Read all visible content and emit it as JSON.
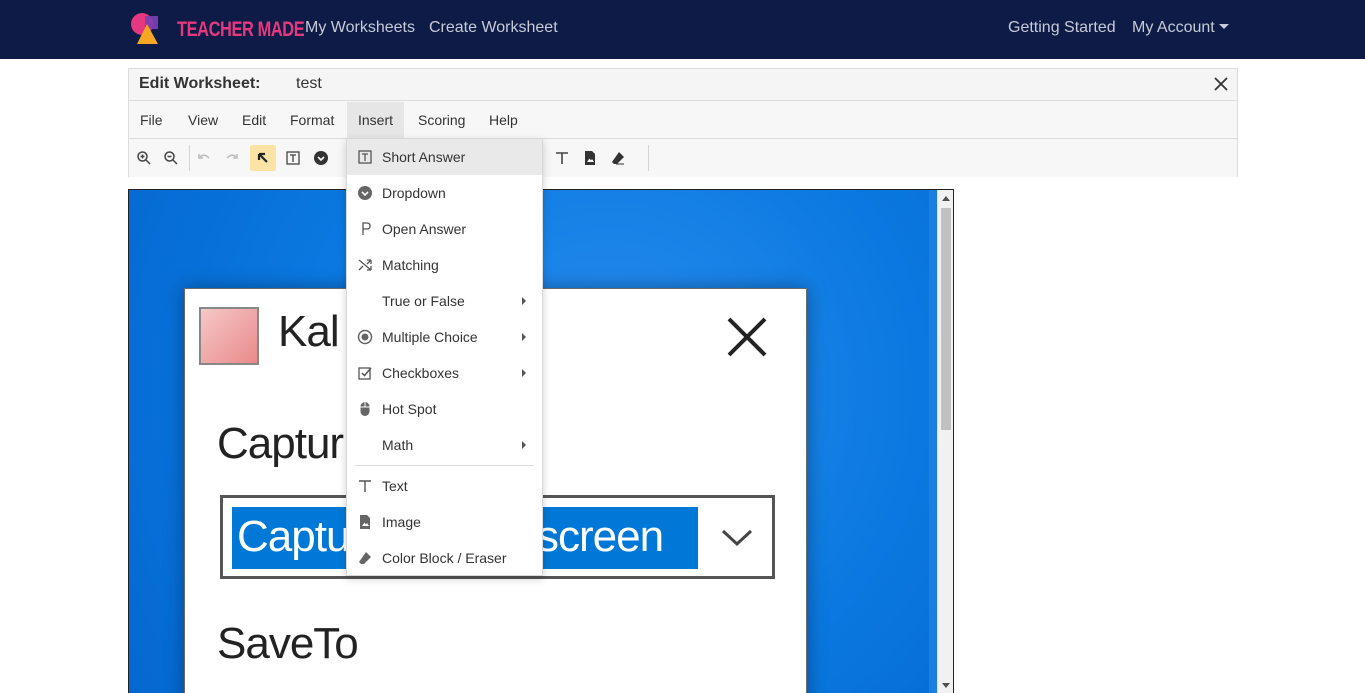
{
  "nav": {
    "brand": "TEACHER MADE",
    "links": [
      "My Worksheets",
      "Create Worksheet"
    ],
    "right_links": [
      "Getting Started",
      "My Account"
    ],
    "bg_color": "#0d1b46",
    "brand_color": "#e6387f"
  },
  "editor": {
    "title_label": "Edit Worksheet:",
    "worksheet_name": "test",
    "menus": [
      "File",
      "View",
      "Edit",
      "Format",
      "Insert",
      "Scoring",
      "Help"
    ],
    "active_menu": "Insert"
  },
  "insert_menu": {
    "items": [
      {
        "label": "Short Answer",
        "icon": "text-box-icon",
        "submenu": false
      },
      {
        "label": "Dropdown",
        "icon": "dropdown-circle-icon",
        "submenu": false
      },
      {
        "label": "Open Answer",
        "icon": "paragraph-icon",
        "submenu": false
      },
      {
        "label": "Matching",
        "icon": "shuffle-icon",
        "submenu": false
      },
      {
        "label": "True or False",
        "icon": "",
        "submenu": true
      },
      {
        "label": "Multiple Choice",
        "icon": "radio-icon",
        "submenu": true
      },
      {
        "label": "Checkboxes",
        "icon": "checkbox-icon",
        "submenu": true
      },
      {
        "label": "Hot Spot",
        "icon": "mouse-icon",
        "submenu": false
      },
      {
        "label": "Math",
        "icon": "",
        "submenu": true
      },
      {
        "label": "Text",
        "icon": "text-icon",
        "submenu": false
      },
      {
        "label": "Image",
        "icon": "image-icon",
        "submenu": false
      },
      {
        "label": "Color Block / Eraser",
        "icon": "eraser-icon",
        "submenu": false
      }
    ],
    "highlighted": "Short Answer"
  },
  "canvas": {
    "dialog_title": "Kal",
    "capture_label": "Captur",
    "select_text_left": "Captu",
    "select_text_right": "screen",
    "save_label": "SaveTo",
    "select_highlight": "#0078d7"
  }
}
